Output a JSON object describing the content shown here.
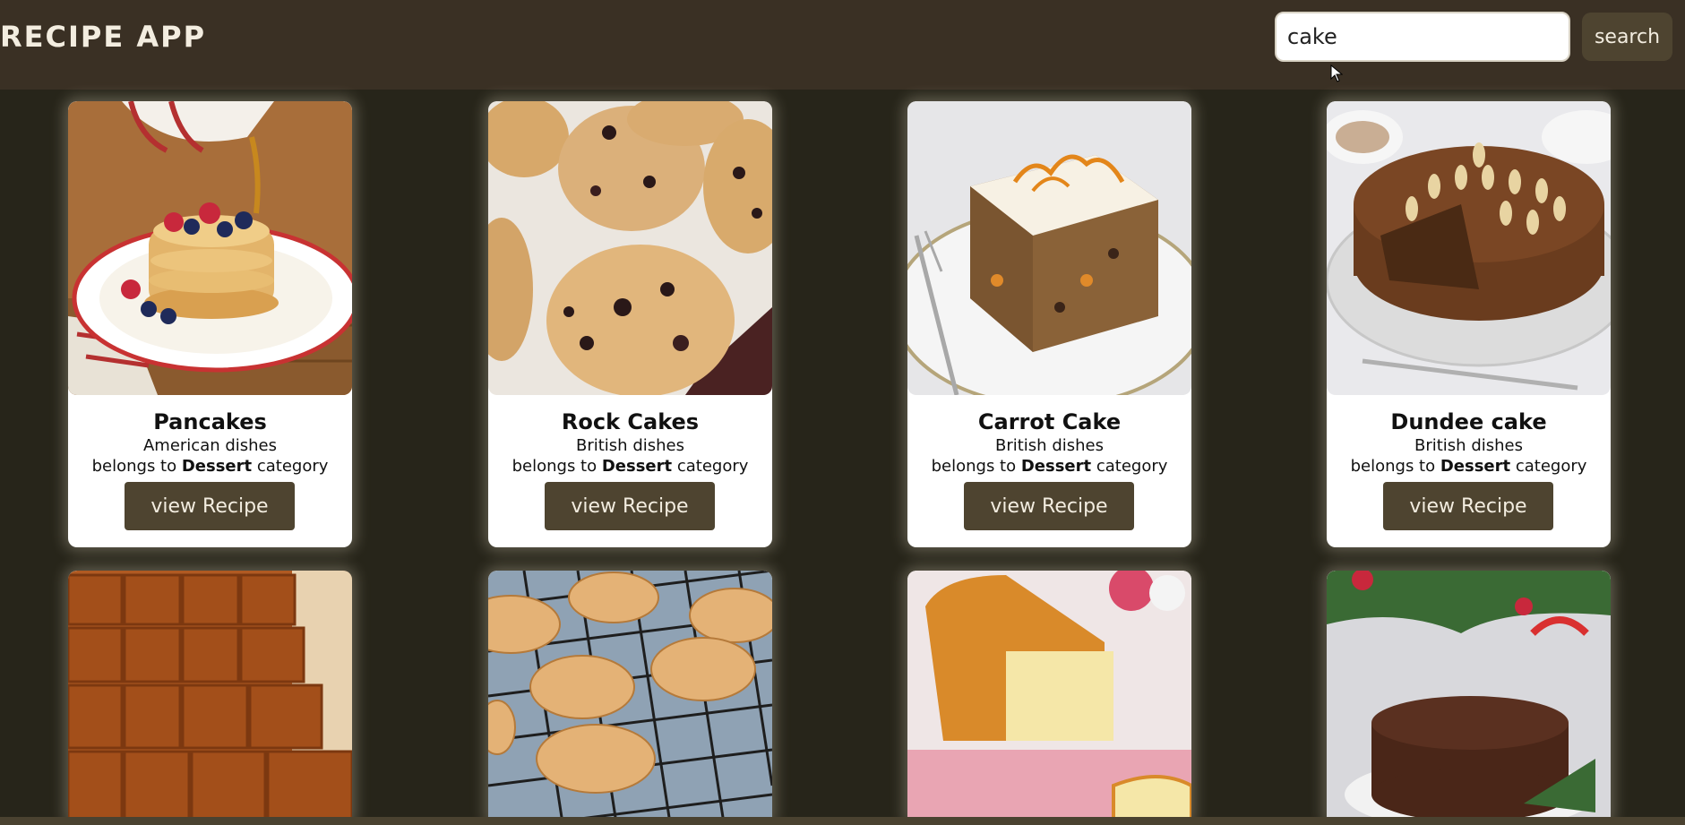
{
  "header": {
    "title": "RECIPE APP",
    "search_value": "cake",
    "search_button_label": "search"
  },
  "cards": [
    {
      "name": "Pancakes",
      "area": "American dishes",
      "belongs_prefix": "belongs to ",
      "category": "Dessert",
      "belongs_suffix": " category",
      "button_label": "view Recipe"
    },
    {
      "name": "Rock Cakes",
      "area": "British dishes",
      "belongs_prefix": "belongs to ",
      "category": "Dessert",
      "belongs_suffix": " category",
      "button_label": "view Recipe"
    },
    {
      "name": "Carrot Cake",
      "area": "British dishes",
      "belongs_prefix": "belongs to ",
      "category": "Dessert",
      "belongs_suffix": " category",
      "button_label": "view Recipe"
    },
    {
      "name": "Dundee cake",
      "area": "British dishes",
      "belongs_prefix": "belongs to ",
      "category": "Dessert",
      "belongs_suffix": " category",
      "button_label": "view Recipe"
    }
  ],
  "colors": {
    "background": "#27251a",
    "header": "#3a3024",
    "button": "#4e4430",
    "card": "#ffffff"
  }
}
